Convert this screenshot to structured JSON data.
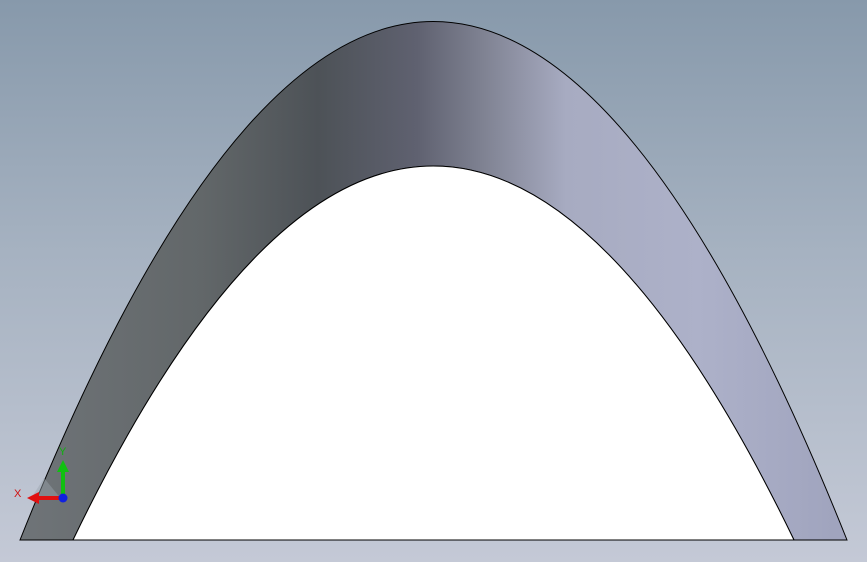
{
  "viewport": {
    "background_top": "#8799ab",
    "background_bottom": "#c4c9d6"
  },
  "model": {
    "shape": "parabolic-arch",
    "opening_fill": "#ffffff",
    "edge_color": "#000000"
  },
  "triad": {
    "x_label": "X",
    "y_label": "Y",
    "x_color": "#e01010",
    "y_color": "#10c010",
    "z_color": "#1020e0"
  }
}
